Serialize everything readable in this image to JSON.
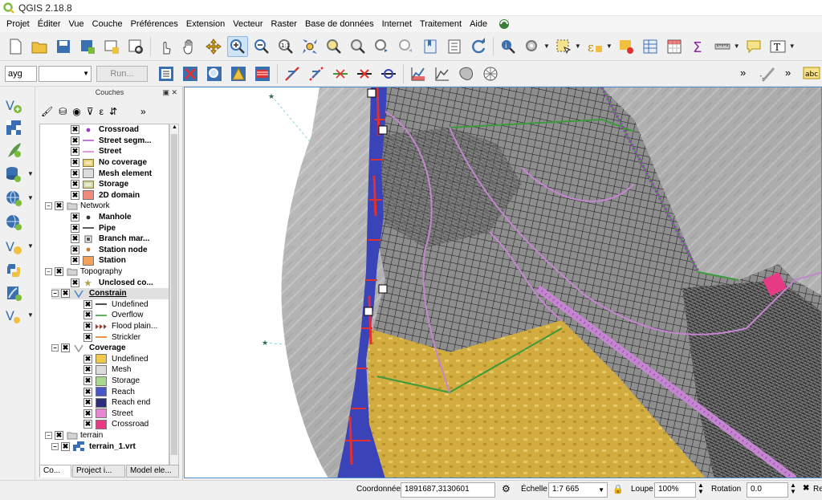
{
  "window": {
    "title": "QGIS 2.18.8"
  },
  "menu": [
    "Projet",
    "Éditer",
    "Vue",
    "Couche",
    "Préférences",
    "Extension",
    "Vecteur",
    "Raster",
    "Base de données",
    "Internet",
    "Traitement",
    "Aide"
  ],
  "toolbar2": {
    "algorithm_value": "ayg",
    "run_label": "Run..."
  },
  "overflow_glyph": "»",
  "panel": {
    "title": "Couches",
    "ctrls": "▣ ✕",
    "layers": [
      {
        "level": 2,
        "checked": true,
        "bold": true,
        "symbol": "dot",
        "color": "#9b3fbf",
        "label": "Crossroad"
      },
      {
        "level": 2,
        "checked": true,
        "bold": true,
        "symbol": "line",
        "color": "#b05cc9",
        "label": "Street segm..."
      },
      {
        "level": 2,
        "checked": true,
        "bold": true,
        "symbol": "line",
        "color": "#e27ed8",
        "label": "Street"
      },
      {
        "level": 2,
        "checked": true,
        "bold": true,
        "symbol": "badge",
        "color": "#e6cf70",
        "label": "No coverage"
      },
      {
        "level": 2,
        "checked": true,
        "bold": true,
        "symbol": "box",
        "color": "#dcdcdc",
        "label": "Mesh element"
      },
      {
        "level": 2,
        "checked": true,
        "bold": true,
        "symbol": "badge",
        "color": "#cfd6a6",
        "label": "Storage"
      },
      {
        "level": 2,
        "checked": true,
        "bold": true,
        "symbol": "box",
        "color": "#f08a7e",
        "label": "2D domain"
      },
      {
        "level": 0,
        "group": true,
        "checked": true,
        "bold": false,
        "label": "Network"
      },
      {
        "level": 2,
        "checked": true,
        "bold": true,
        "symbol": "dot",
        "color": "#333333",
        "label": "Manhole"
      },
      {
        "level": 2,
        "checked": true,
        "bold": true,
        "symbol": "line",
        "color": "#333333",
        "label": "Pipe"
      },
      {
        "level": 2,
        "checked": true,
        "bold": true,
        "symbol": "square",
        "color": "#555555",
        "label": "Branch mar..."
      },
      {
        "level": 2,
        "checked": true,
        "bold": true,
        "symbol": "dot",
        "color": "#c57a2d",
        "label": "Station node"
      },
      {
        "level": 2,
        "checked": true,
        "bold": true,
        "symbol": "box",
        "color": "#f5a05a",
        "label": "Station"
      },
      {
        "level": 0,
        "group": true,
        "checked": true,
        "bold": false,
        "label": "Topography"
      },
      {
        "level": 2,
        "checked": true,
        "bold": true,
        "symbol": "star",
        "color": "#b3a24a",
        "label": "Unclosed co..."
      },
      {
        "level": 1,
        "checked": true,
        "bold": true,
        "underline": true,
        "selected": true,
        "symbol": "vee",
        "color": "#4f88c6",
        "label": "Constrain"
      },
      {
        "level": 3,
        "checked": true,
        "bold": false,
        "symbol": "line",
        "color": "#222222",
        "label": "Undefined"
      },
      {
        "level": 3,
        "checked": true,
        "bold": false,
        "symbol": "line",
        "color": "#3c9a3c",
        "label": "Overflow"
      },
      {
        "level": 3,
        "checked": true,
        "bold": false,
        "symbol": "arrows",
        "color": "#9a3d2d",
        "label": "Flood plain..."
      },
      {
        "level": 3,
        "checked": true,
        "bold": false,
        "symbol": "line",
        "color": "#e07a20",
        "label": "Strickler"
      },
      {
        "level": 1,
        "checked": true,
        "bold": true,
        "symbol": "vee-gray",
        "color": "#9a9a9a",
        "label": "Coverage"
      },
      {
        "level": 3,
        "checked": true,
        "bold": false,
        "symbol": "swatch",
        "color": "#f0c84a",
        "label": "Undefined"
      },
      {
        "level": 3,
        "checked": true,
        "bold": false,
        "symbol": "swatch",
        "color": "#dcdcdc",
        "label": "Mesh"
      },
      {
        "level": 3,
        "checked": true,
        "bold": false,
        "symbol": "swatch",
        "color": "#a9d88f",
        "label": "Storage"
      },
      {
        "level": 3,
        "checked": true,
        "bold": false,
        "symbol": "swatch",
        "color": "#4a55c9",
        "label": "Reach"
      },
      {
        "level": 3,
        "checked": true,
        "bold": false,
        "symbol": "swatch",
        "color": "#2b2f7a",
        "label": "Reach end"
      },
      {
        "level": 3,
        "checked": true,
        "bold": false,
        "symbol": "swatch",
        "color": "#e887d1",
        "label": "Street"
      },
      {
        "level": 3,
        "checked": true,
        "bold": false,
        "symbol": "swatch",
        "color": "#e63a85",
        "label": "Crossroad"
      },
      {
        "level": 0,
        "group": true,
        "checked": true,
        "bold": false,
        "label": "terrain"
      },
      {
        "level": 1,
        "checked": true,
        "bold": true,
        "symbol": "raster",
        "color": "#3a6fb5",
        "label": "terrain_1.vrt"
      }
    ],
    "tabs": [
      "Co...",
      "Project i...",
      "Model ele..."
    ]
  },
  "statusbar": {
    "coord_label": "Coordonnée",
    "coord_value": "1891687,3130601",
    "scale_label": "Échelle",
    "scale_value": "1:7 665",
    "zoom_label": "Loupe",
    "zoom_value": "100%",
    "rotation_label": "Rotation",
    "rotation_value": "0.0",
    "render_label": "Re"
  },
  "colors": {
    "accent": "#4d90d0",
    "hillshade": "#a6a6a6",
    "coverage_undefined": "#d9b33a",
    "reach": "#3a43b8",
    "mesh": "#1a1a1a",
    "street": "#c486cf",
    "overflow": "#3c9a3c"
  }
}
